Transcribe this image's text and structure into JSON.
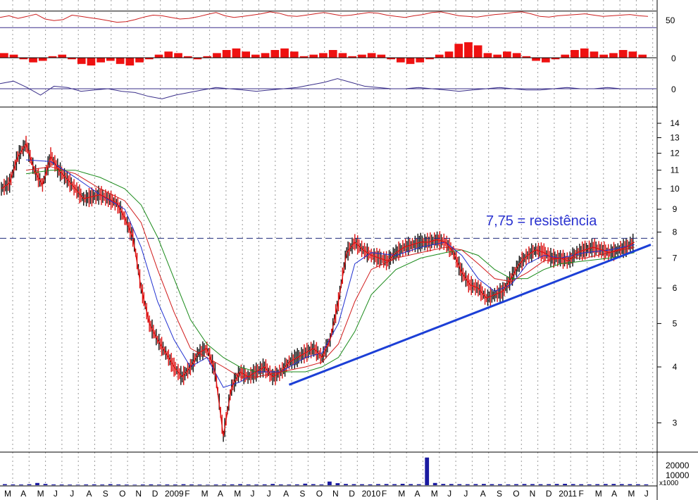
{
  "chart_data": {
    "type": "line",
    "colors": {
      "background": "#ffffff",
      "rsi": "#cc1f1f",
      "histogram": "#ee1111",
      "oscillator": "#3a2f8a",
      "price_up": "#111111",
      "price_down": "#dd1111",
      "ma_fast": "#1f2fd0",
      "ma_mid": "#d01818",
      "ma_slow": "#1a8a1a",
      "trendline": "#1c3fd6",
      "resistance": "#1f2a7a",
      "annotation": "#2b33d0",
      "volume": "#1a1aa0",
      "grid": "#9a9a9a",
      "frame": "#000000"
    },
    "x_axis": {
      "month_labels": [
        "M",
        "A",
        "M",
        "J",
        "J",
        "A",
        "S",
        "O",
        "N",
        "D",
        "2009",
        "F",
        "M",
        "A",
        "M",
        "J",
        "J",
        "A",
        "S",
        "O",
        "N",
        "D",
        "2010",
        "F",
        "M",
        "A",
        "M",
        "J",
        "J",
        "A",
        "S",
        "O",
        "N",
        "D",
        "2011",
        "F",
        "M",
        "A",
        "M",
        "J"
      ]
    },
    "rsi_panel": {
      "tick_labels": [
        "50"
      ],
      "range": [
        0,
        100
      ],
      "upper_line": 70,
      "lower_line": 30,
      "values": [
        55,
        60,
        52,
        58,
        65,
        50,
        45,
        48,
        62,
        58,
        54,
        50,
        45,
        40,
        42,
        48,
        56,
        62,
        60,
        55,
        50,
        52,
        57,
        64,
        70,
        60,
        55,
        58,
        62,
        66,
        72,
        68,
        60,
        58,
        62,
        66,
        70,
        65,
        60,
        62,
        66,
        70,
        68,
        62,
        58,
        55,
        60,
        64,
        70,
        72,
        66,
        60,
        58,
        56,
        60,
        64,
        66,
        70,
        72,
        66,
        58,
        56,
        60,
        62,
        64,
        66,
        62,
        58,
        60,
        62,
        64,
        60,
        58
      ]
    },
    "histogram_panel": {
      "tick_labels": [
        "0"
      ],
      "values": [
        0.3,
        0.2,
        -0.1,
        -0.3,
        -0.2,
        0.1,
        0.2,
        -0.1,
        -0.4,
        -0.5,
        -0.3,
        -0.2,
        -0.4,
        -0.5,
        -0.3,
        -0.1,
        0.2,
        0.4,
        0.3,
        0.1,
        -0.1,
        0.1,
        0.3,
        0.5,
        0.6,
        0.4,
        0.2,
        0.3,
        0.5,
        0.6,
        0.4,
        0.1,
        0.2,
        0.3,
        0.5,
        0.3,
        0.1,
        0.2,
        0.3,
        0.2,
        -0.1,
        -0.3,
        -0.4,
        -0.3,
        -0.1,
        0.2,
        0.4,
        0.9,
        1.0,
        0.8,
        0.3,
        0.2,
        0.4,
        0.3,
        0.1,
        -0.2,
        -0.3,
        -0.1,
        0.2,
        0.5,
        0.6,
        0.4,
        0.2,
        0.3,
        0.5,
        0.4,
        0.2
      ]
    },
    "oscillator_panel": {
      "tick_labels": [
        "0"
      ],
      "values": [
        0.4,
        0.6,
        0.1,
        -0.5,
        0.2,
        0.1,
        -0.2,
        -0.1,
        0.0,
        -0.2,
        -0.3,
        -0.6,
        -0.8,
        -0.5,
        -0.3,
        -0.1,
        0.1,
        0.0,
        -0.1,
        -0.2,
        -0.1,
        0.0,
        0.1,
        0.3,
        0.5,
        0.8,
        0.5,
        0.2,
        0.1,
        0.0,
        0.0,
        0.1,
        0.0,
        -0.1,
        -0.2,
        -0.1,
        0.0,
        0.1,
        0.0,
        -0.1,
        -0.1,
        0.0,
        0.1,
        0.0,
        0.0,
        0.1,
        0.0,
        0.0,
        0.0
      ]
    },
    "price_panel": {
      "scale": "log",
      "ylim": [
        2.6,
        15
      ],
      "tick_labels": [
        "14",
        "13",
        "12",
        "11",
        "10",
        "9",
        "8",
        "7",
        "6",
        "5",
        "4",
        "3"
      ],
      "tick_values": [
        14,
        13,
        12,
        11,
        10,
        9,
        8,
        7,
        6,
        5,
        4,
        3
      ],
      "close_series": [
        [
          0,
          10.0
        ],
        [
          1,
          10.3
        ],
        [
          2,
          11.8
        ],
        [
          3,
          12.6
        ],
        [
          4,
          11.0
        ],
        [
          5,
          10.2
        ],
        [
          6,
          11.8
        ],
        [
          7,
          11.0
        ],
        [
          8,
          10.5
        ],
        [
          9,
          10.0
        ],
        [
          10,
          9.5
        ],
        [
          11,
          9.6
        ],
        [
          12,
          9.7
        ],
        [
          13,
          9.5
        ],
        [
          14,
          9.3
        ],
        [
          15,
          8.6
        ],
        [
          16,
          7.8
        ],
        [
          17,
          6.0
        ],
        [
          18,
          5.0
        ],
        [
          19,
          4.6
        ],
        [
          20,
          4.3
        ],
        [
          21,
          4.0
        ],
        [
          22,
          3.8
        ],
        [
          23,
          4.0
        ],
        [
          24,
          4.3
        ],
        [
          25,
          4.4
        ],
        [
          26,
          3.9
        ],
        [
          27,
          2.8
        ],
        [
          28,
          3.6
        ],
        [
          29,
          3.9
        ],
        [
          30,
          3.8
        ],
        [
          31,
          3.9
        ],
        [
          32,
          4.0
        ],
        [
          33,
          3.8
        ],
        [
          34,
          3.9
        ],
        [
          35,
          4.1
        ],
        [
          36,
          4.2
        ],
        [
          37,
          4.3
        ],
        [
          38,
          4.4
        ],
        [
          39,
          4.2
        ],
        [
          40,
          4.6
        ],
        [
          41,
          5.6
        ],
        [
          42,
          7.2
        ],
        [
          43,
          7.6
        ],
        [
          44,
          7.3
        ],
        [
          45,
          7.1
        ],
        [
          46,
          7.0
        ],
        [
          47,
          6.9
        ],
        [
          48,
          7.2
        ],
        [
          49,
          7.4
        ],
        [
          50,
          7.5
        ],
        [
          51,
          7.6
        ],
        [
          52,
          7.6
        ],
        [
          53,
          7.7
        ],
        [
          54,
          7.6
        ],
        [
          55,
          7.2
        ],
        [
          56,
          6.5
        ],
        [
          57,
          6.1
        ],
        [
          58,
          6.0
        ],
        [
          59,
          5.7
        ],
        [
          60,
          5.8
        ],
        [
          61,
          5.9
        ],
        [
          62,
          6.3
        ],
        [
          63,
          6.8
        ],
        [
          64,
          7.1
        ],
        [
          65,
          7.3
        ],
        [
          66,
          7.2
        ],
        [
          67,
          7.0
        ],
        [
          68,
          7.0
        ],
        [
          69,
          6.9
        ],
        [
          70,
          7.2
        ],
        [
          71,
          7.3
        ],
        [
          72,
          7.4
        ],
        [
          73,
          7.3
        ],
        [
          74,
          7.2
        ],
        [
          75,
          7.3
        ],
        [
          76,
          7.4
        ],
        [
          77,
          7.6
        ]
      ],
      "ma_fast": [
        [
          3,
          11.6
        ],
        [
          6,
          11.5
        ],
        [
          9,
          10.6
        ],
        [
          12,
          9.7
        ],
        [
          15,
          9.0
        ],
        [
          17,
          7.4
        ],
        [
          19,
          5.6
        ],
        [
          21,
          4.6
        ],
        [
          23,
          4.0
        ],
        [
          25,
          4.2
        ],
        [
          27,
          3.6
        ],
        [
          29,
          3.7
        ],
        [
          31,
          3.9
        ],
        [
          34,
          3.9
        ],
        [
          37,
          4.2
        ],
        [
          39,
          4.3
        ],
        [
          41,
          5.0
        ],
        [
          43,
          6.8
        ],
        [
          45,
          7.2
        ],
        [
          48,
          7.1
        ],
        [
          51,
          7.4
        ],
        [
          54,
          7.6
        ],
        [
          56,
          7.1
        ],
        [
          58,
          6.3
        ],
        [
          60,
          5.9
        ],
        [
          62,
          6.1
        ],
        [
          64,
          6.8
        ],
        [
          66,
          7.1
        ],
        [
          68,
          7.0
        ],
        [
          71,
          7.2
        ],
        [
          74,
          7.3
        ],
        [
          77,
          7.5
        ]
      ],
      "ma_mid": [
        [
          3,
          11.0
        ],
        [
          6,
          11.2
        ],
        [
          9,
          10.8
        ],
        [
          12,
          10.0
        ],
        [
          15,
          9.4
        ],
        [
          17,
          8.4
        ],
        [
          19,
          6.6
        ],
        [
          21,
          5.3
        ],
        [
          23,
          4.4
        ],
        [
          25,
          4.2
        ],
        [
          27,
          4.0
        ],
        [
          29,
          3.8
        ],
        [
          31,
          3.8
        ],
        [
          34,
          3.9
        ],
        [
          37,
          4.0
        ],
        [
          39,
          4.1
        ],
        [
          41,
          4.5
        ],
        [
          43,
          5.6
        ],
        [
          45,
          6.6
        ],
        [
          48,
          7.0
        ],
        [
          51,
          7.2
        ],
        [
          54,
          7.4
        ],
        [
          56,
          7.3
        ],
        [
          58,
          6.8
        ],
        [
          60,
          6.3
        ],
        [
          62,
          6.2
        ],
        [
          64,
          6.5
        ],
        [
          66,
          6.9
        ],
        [
          68,
          7.0
        ],
        [
          71,
          7.0
        ],
        [
          74,
          7.2
        ],
        [
          77,
          7.4
        ]
      ],
      "ma_slow": [
        [
          3,
          10.8
        ],
        [
          6,
          11.0
        ],
        [
          9,
          11.0
        ],
        [
          12,
          10.6
        ],
        [
          15,
          10.0
        ],
        [
          17,
          9.2
        ],
        [
          19,
          7.8
        ],
        [
          21,
          6.3
        ],
        [
          23,
          5.1
        ],
        [
          25,
          4.5
        ],
        [
          27,
          4.2
        ],
        [
          29,
          4.0
        ],
        [
          31,
          3.9
        ],
        [
          34,
          3.9
        ],
        [
          37,
          3.9
        ],
        [
          39,
          4.0
        ],
        [
          41,
          4.2
        ],
        [
          43,
          4.8
        ],
        [
          45,
          5.8
        ],
        [
          48,
          6.6
        ],
        [
          51,
          7.0
        ],
        [
          54,
          7.2
        ],
        [
          56,
          7.3
        ],
        [
          58,
          7.1
        ],
        [
          60,
          6.6
        ],
        [
          62,
          6.3
        ],
        [
          64,
          6.3
        ],
        [
          66,
          6.6
        ],
        [
          68,
          6.8
        ],
        [
          71,
          6.9
        ],
        [
          74,
          7.0
        ],
        [
          77,
          7.2
        ]
      ],
      "trendline": {
        "x": [
          35,
          79
        ],
        "y": [
          3.65,
          7.5
        ]
      },
      "resistance": {
        "value": 7.75
      },
      "annotation": "7,75 = resistência"
    },
    "volume_panel": {
      "tick_labels": [
        "20000",
        "10000"
      ],
      "unit_label": "x1000",
      "range": [
        0,
        35000
      ],
      "values": [
        1200,
        900,
        800,
        1100,
        2600,
        1500,
        900,
        800,
        700,
        600,
        900,
        1000,
        800,
        1200,
        900,
        700,
        600,
        800,
        1000,
        700,
        900,
        800,
        1100,
        900,
        700,
        600,
        800,
        900,
        1000,
        1200,
        900,
        800,
        1000,
        1500,
        900,
        800,
        1000,
        1800,
        1200,
        900,
        4200,
        2400,
        1500,
        1200,
        1100,
        1000,
        1300,
        1400,
        1200,
        1600,
        1300,
        1100,
        32000,
        2600,
        1500,
        1400,
        1200,
        1100,
        1300,
        1500,
        1200,
        1100,
        1000,
        1200,
        1400,
        1300,
        1100,
        1200,
        1500,
        1600,
        1300,
        1100,
        1000,
        1200,
        1400,
        1500,
        1300,
        1200,
        1100,
        1000
      ]
    }
  }
}
